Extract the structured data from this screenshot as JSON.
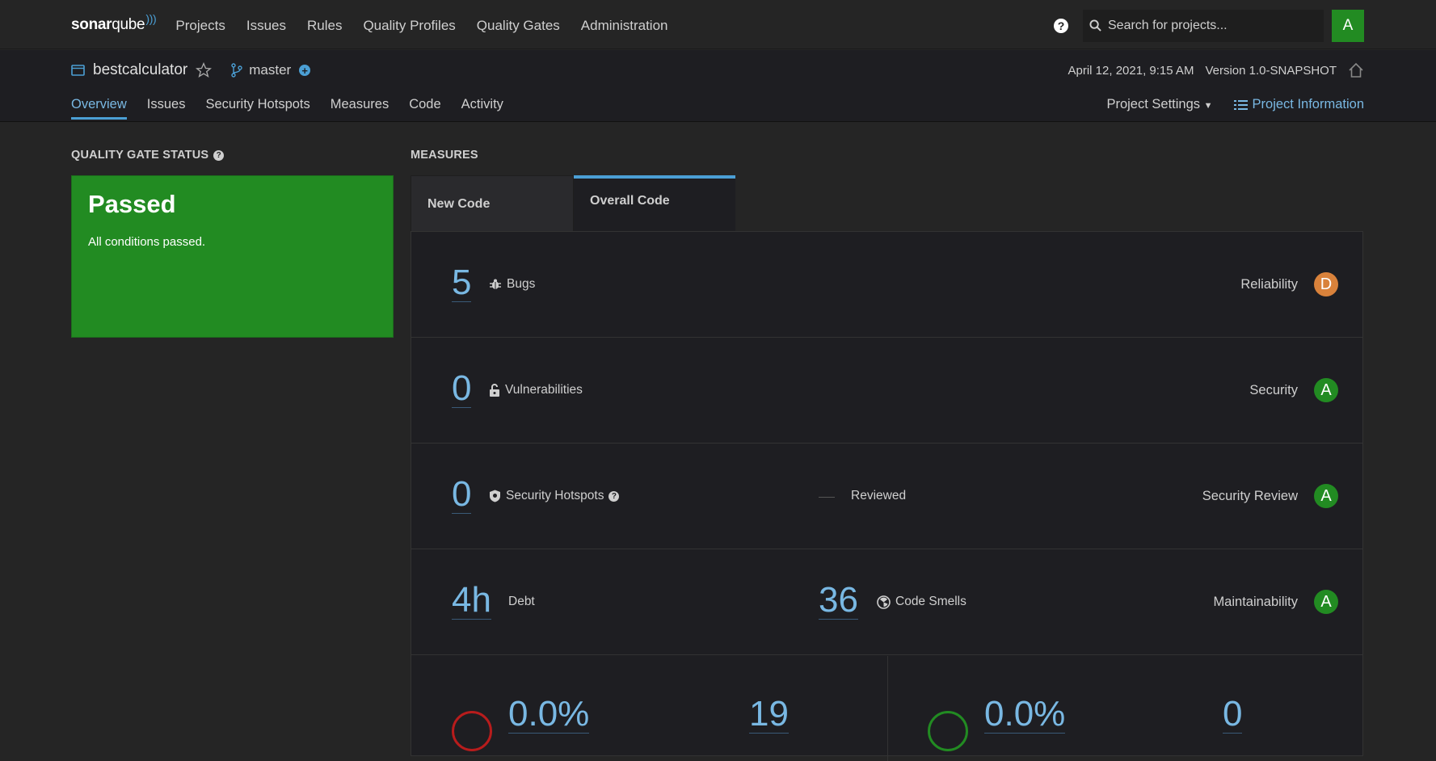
{
  "topbar": {
    "logo_text_bold": "sonar",
    "logo_text": "qube",
    "nav": [
      "Projects",
      "Issues",
      "Rules",
      "Quality Profiles",
      "Quality Gates",
      "Administration"
    ],
    "search_placeholder": "Search for projects...",
    "avatar_letter": "A",
    "help_icon": "?"
  },
  "project": {
    "name": "bestcalculator",
    "branch": "master",
    "date": "April 12, 2021, 9:15 AM",
    "version": "Version 1.0-SNAPSHOT",
    "tabs": [
      "Overview",
      "Issues",
      "Security Hotspots",
      "Measures",
      "Code",
      "Activity"
    ],
    "active_tab": "Overview",
    "settings_label": "Project Settings",
    "info_label": "Project Information"
  },
  "quality_gate": {
    "title": "QUALITY GATE STATUS",
    "status": "Passed",
    "message": "All conditions passed.",
    "status_color": "#228b22"
  },
  "measures": {
    "title": "MEASURES",
    "tabs": [
      "New Code",
      "Overall Code"
    ],
    "active_tab": "Overall Code",
    "bugs": {
      "value": "5",
      "label": "Bugs",
      "rating_label": "Reliability",
      "rating": "D"
    },
    "vulnerabilities": {
      "value": "0",
      "label": "Vulnerabilities",
      "rating_label": "Security",
      "rating": "A"
    },
    "hotspots": {
      "value": "0",
      "label": "Security Hotspots",
      "reviewed_label": "Reviewed",
      "rating_label": "Security Review",
      "rating": "A"
    },
    "debt": {
      "value": "4h",
      "label": "Debt",
      "smells_value": "36",
      "smells_label": "Code Smells",
      "rating_label": "Maintainability",
      "rating": "A"
    },
    "coverage": {
      "value": "0.0%",
      "unit_tests_value": "19"
    },
    "duplications": {
      "value": "0.0%",
      "duplicated_blocks_value": "0"
    }
  },
  "colors": {
    "accent": "#4b9fd5",
    "link": "#79b8e3",
    "rating_a": "#228b22",
    "rating_d": "#d9823b",
    "coverage_ring": "#b81c1c",
    "dup_ring": "#228b22"
  }
}
